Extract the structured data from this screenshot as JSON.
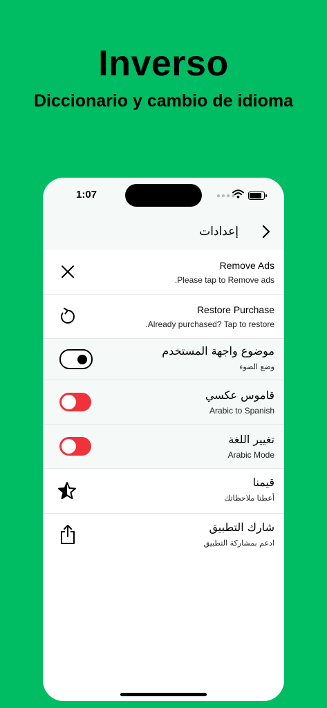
{
  "promo": {
    "title": "Inverso",
    "subtitle": "Diccionario y cambio de idioma"
  },
  "status_bar": {
    "time": "1:07",
    "signal_icon": "signal-dots-icon",
    "wifi_icon": "wifi-icon",
    "battery_icon": "battery-icon"
  },
  "nav": {
    "title": "إعدادات",
    "back_icon": "chevron-right-icon"
  },
  "settings": [
    {
      "title": "Remove Ads",
      "subtitle": ".Please tap to Remove ads",
      "icon": "close-icon"
    },
    {
      "title": "Restore Purchase",
      "subtitle": ".Already purchased? Tap to restore",
      "icon": "refresh-icon"
    },
    {
      "title": "موضوع واجهة المستخدم",
      "subtitle": "وضع الضوء",
      "control": "toggle-on"
    },
    {
      "title": "قاموس عكسي",
      "subtitle": "Arabic to Spanish",
      "control": "toggle-off"
    },
    {
      "title": "تغيير اللغة",
      "subtitle": "Arabic Mode",
      "control": "toggle-off"
    },
    {
      "title": "قيمنا",
      "subtitle": "أعطنا ملاحظاتك",
      "icon": "star-icon"
    },
    {
      "title": "شارك التطبيق",
      "subtitle": "ادعم بمشاركة التطبيق",
      "icon": "share-icon"
    }
  ],
  "colors": {
    "background": "#00bd63",
    "toggle_off": "#f0323a",
    "row_tint": "#f5faf8"
  }
}
